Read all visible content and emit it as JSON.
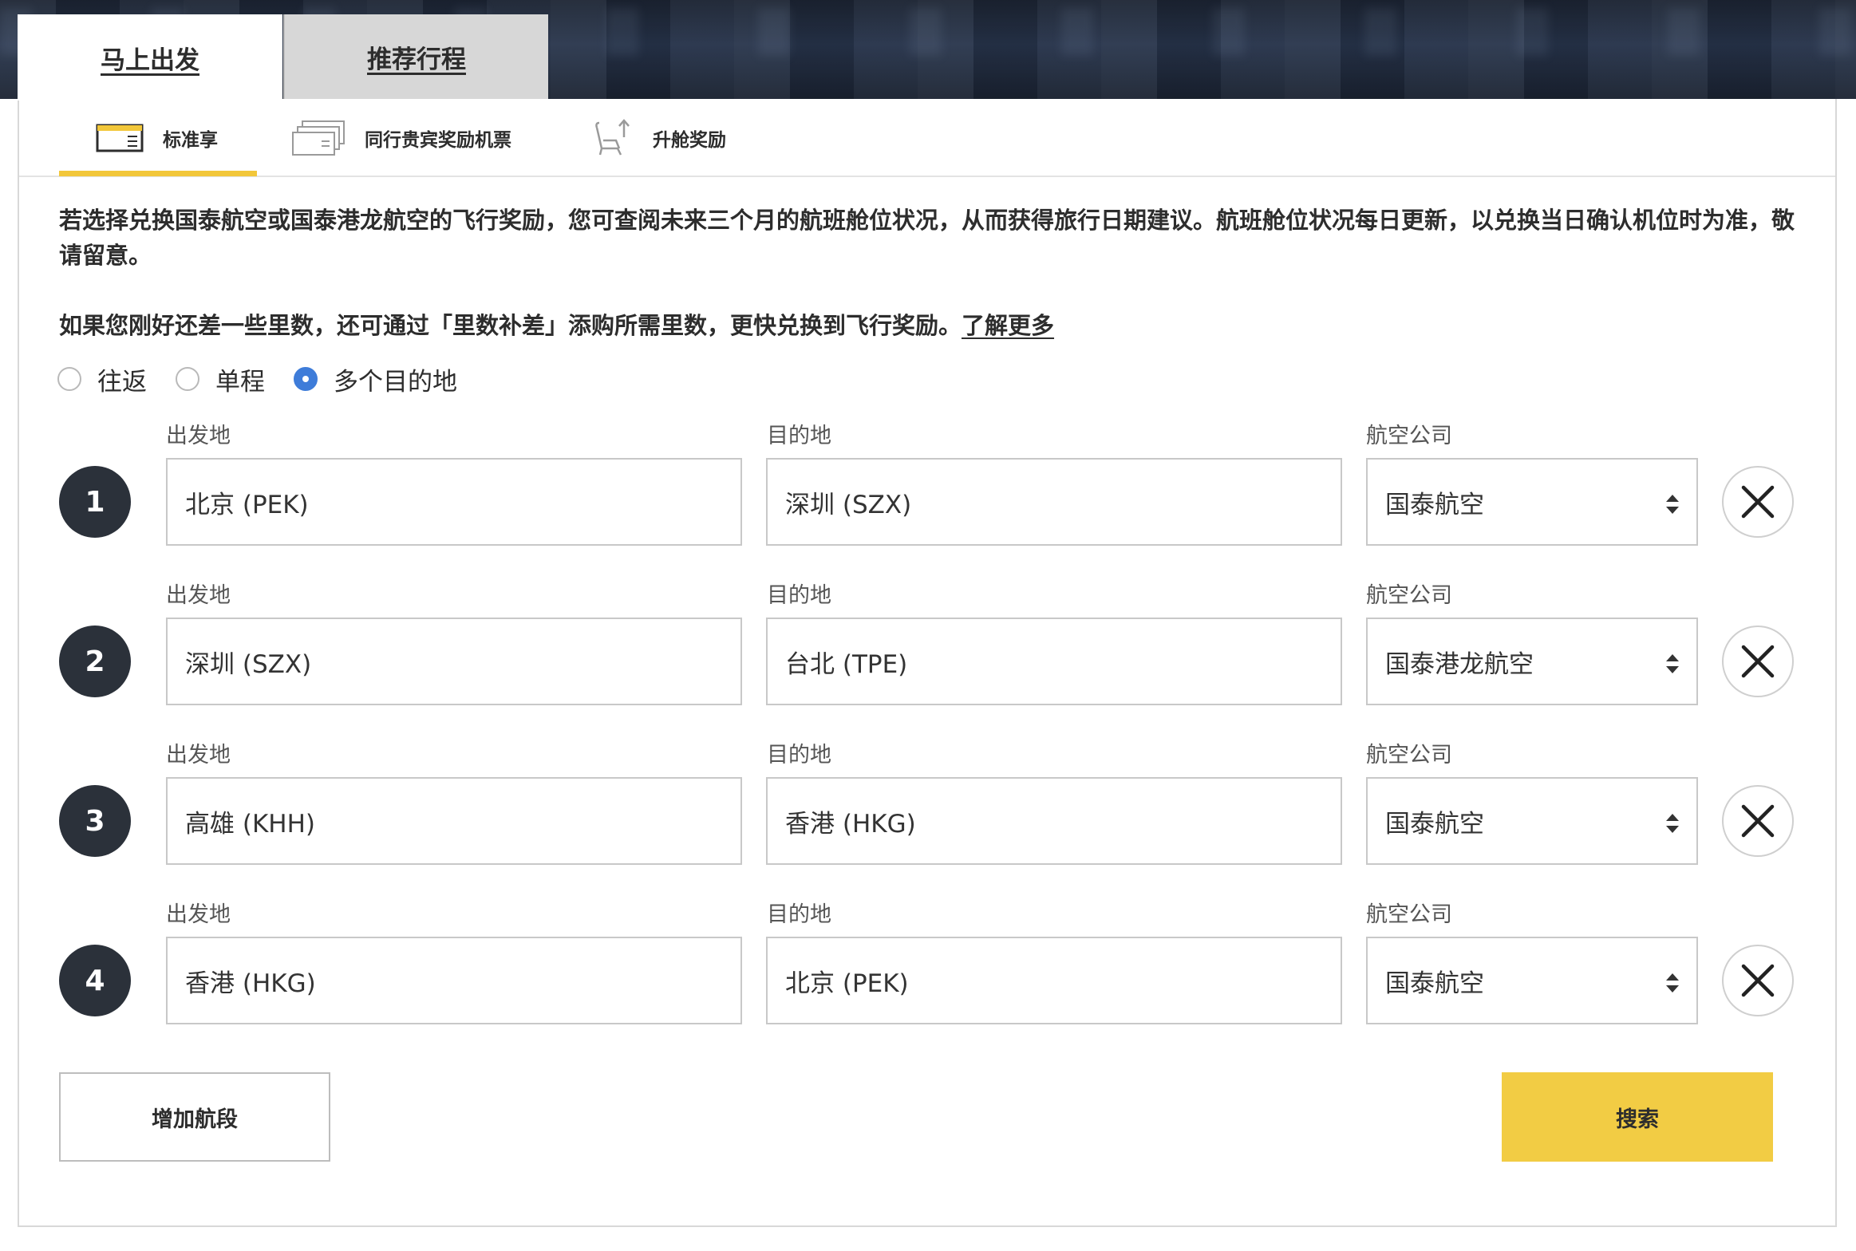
{
  "tabs": [
    {
      "label": "马上出发",
      "active": true
    },
    {
      "label": "推荐行程",
      "active": false
    }
  ],
  "subtabs": [
    {
      "label": "标准享",
      "icon": "standard-ticket-icon",
      "active": true
    },
    {
      "label": "同行贵宾奖励机票",
      "icon": "companion-tickets-icon",
      "active": false
    },
    {
      "label": "升舱奖励",
      "icon": "seat-upgrade-icon",
      "active": false
    }
  ],
  "info": {
    "paragraph1": "若选择兑换国泰航空或国泰港龙航空的飞行奖励，您可查阅未来三个月的航班舱位状况，从而获得旅行日期建议。航班舱位状况每日更新，以兑换当日确认机位时为准，敬请留意。",
    "paragraph2": "如果您刚好还差一些里数，还可通过「里数补差」添购所需里数，更快兑换到飞行奖励。",
    "learn_more": "了解更多"
  },
  "trip_type": {
    "options": [
      "往返",
      "单程",
      "多个目的地"
    ],
    "selected": "多个目的地"
  },
  "labels": {
    "origin": "出发地",
    "destination": "目的地",
    "airline": "航空公司"
  },
  "segments": [
    {
      "number": "1",
      "origin": "北京 (PEK)",
      "destination": "深圳 (SZX)",
      "airline": "国泰航空"
    },
    {
      "number": "2",
      "origin": "深圳 (SZX)",
      "destination": "台北 (TPE)",
      "airline": "国泰港龙航空"
    },
    {
      "number": "3",
      "origin": "高雄 (KHH)",
      "destination": "香港 (HKG)",
      "airline": "国泰航空"
    },
    {
      "number": "4",
      "origin": "香港 (HKG)",
      "destination": "北京 (PEK)",
      "airline": "国泰航空"
    }
  ],
  "buttons": {
    "add_segment": "增加航段",
    "search": "搜索"
  },
  "colors": {
    "accent_yellow": "#f2cc44",
    "radio_blue": "#3e7cd9",
    "segment_badge": "#2b313a"
  }
}
